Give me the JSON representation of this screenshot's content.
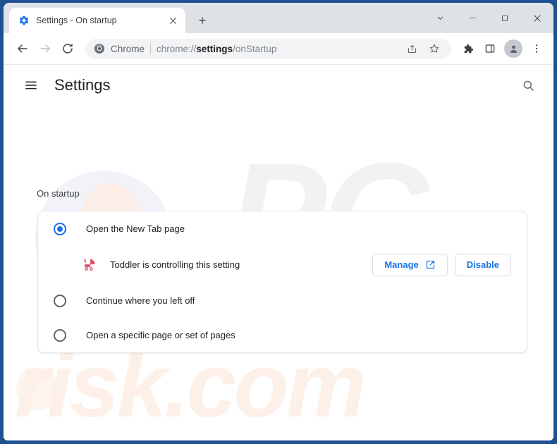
{
  "window": {
    "controls": {
      "chevron_down": "chevron-down",
      "minimize": "minimize",
      "maximize": "maximize",
      "close": "close"
    },
    "frame_color": "#1f5092"
  },
  "tabstrip": {
    "tab": {
      "title": "Settings - On startup",
      "favicon": "settings-gear-icon",
      "close": "close-icon"
    },
    "new_tab_label": "+",
    "background": "#dee1e6"
  },
  "toolbar": {
    "back": "back-arrow-icon",
    "forward": "forward-arrow-icon",
    "reload": "reload-icon",
    "omnibox": {
      "chip_icon": "chrome-logo-icon",
      "chip_label": "Chrome",
      "url_prefix": "chrome://",
      "url_bold": "settings",
      "url_suffix": "/onStartup",
      "share_icon": "share-icon",
      "bookmark_icon": "star-icon"
    },
    "extensions_icon": "puzzle-piece-icon",
    "side_panel_icon": "side-panel-icon",
    "profile_icon": "profile-avatar-icon",
    "menu_icon": "three-dot-menu-icon"
  },
  "settings": {
    "menu_icon": "hamburger-menu-icon",
    "title": "Settings",
    "search_icon": "search-icon",
    "section_label": "On startup",
    "accent_color": "#1a73e8",
    "options": [
      {
        "label": "Open the New Tab page",
        "selected": true
      },
      {
        "label": "Continue where you left off",
        "selected": false
      },
      {
        "label": "Open a specific page or set of pages",
        "selected": false
      }
    ],
    "extension_notice": {
      "icon": "baby-stroller-icon",
      "icon_color": "#d8566f",
      "text": "Toddler is controlling this setting",
      "manage_label": "Manage",
      "manage_icon": "external-link-icon",
      "disable_label": "Disable"
    }
  },
  "watermarks": {
    "primary": "PC",
    "secondary": "risk.com"
  }
}
